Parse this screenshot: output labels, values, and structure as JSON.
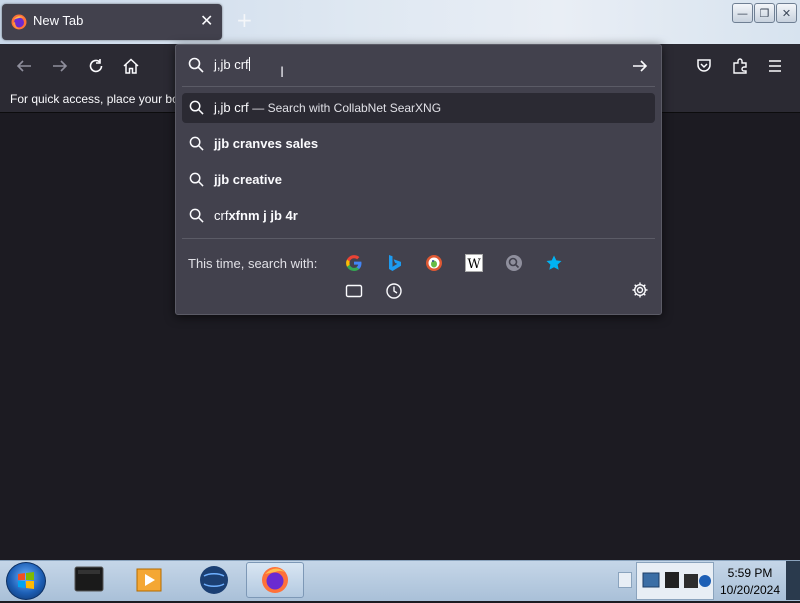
{
  "tab": {
    "title": "New Tab",
    "close_glyph": "✕",
    "favicon": "firefox-icon"
  },
  "new_tab_glyph": "+",
  "window_controls": {
    "minimize": "—",
    "restore": "❐",
    "close": "✕"
  },
  "toolbar": {
    "back": "back-arrow-icon",
    "forward": "forward-arrow-icon",
    "reload": "reload-icon",
    "home": "home-icon",
    "pocket": "pocket-icon",
    "extensions": "extensions-icon",
    "menu": "hamburger-menu-icon"
  },
  "bookmarks_bar": {
    "text": "For quick access, place your bo"
  },
  "urlbar": {
    "value": "j,jb crf",
    "go": "go-arrow-icon",
    "results": [
      {
        "pre": "j,jb crf",
        "bold": "",
        "sub": "— Search with CollabNet SearXNG"
      },
      {
        "pre": "",
        "bold": "jjb cranves sales",
        "sub": ""
      },
      {
        "pre": "",
        "bold": "jjb creative",
        "sub": ""
      },
      {
        "pre": "crf",
        "bold": "xfnm j jb 4r",
        "sub": ""
      }
    ],
    "search_with_label": "This time, search with:",
    "engines": [
      "google-icon",
      "bing-icon",
      "duckduckgo-icon",
      "wikipedia-icon",
      "searxng-icon",
      "bookmarks-star-icon",
      "tabs-icon",
      "history-icon"
    ],
    "settings": "gear-icon"
  },
  "taskbar": {
    "time": "5:59 PM",
    "date": "10/20/2024"
  }
}
